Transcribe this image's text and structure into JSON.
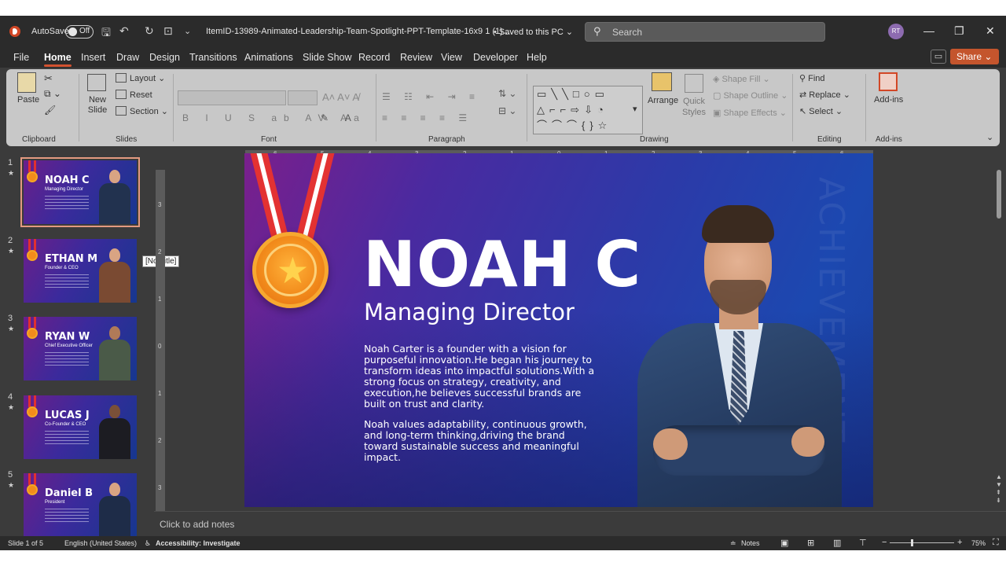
{
  "window": {
    "autosave_label": "AutoSave",
    "autosave_state": "Off",
    "doc_title": "ItemID-13989-Animated-Leadership-Team-Spotlight-PPT-Template-16x9 1 (1)....",
    "saved_status": "• Saved to this PC ⌄",
    "search_placeholder": "Search",
    "avatar_initials": "RT",
    "accent_color": "#d35230"
  },
  "menu": {
    "tabs": [
      "File",
      "Home",
      "Insert",
      "Draw",
      "Design",
      "Transitions",
      "Animations",
      "Slide Show",
      "Record",
      "Review",
      "View",
      "Developer",
      "Help"
    ],
    "active": "Home",
    "share_label": "Share"
  },
  "ribbon": {
    "clipboard": {
      "paste": "Paste",
      "group": "Clipboard"
    },
    "slides": {
      "new_slide": "New Slide",
      "layout": "Layout",
      "reset": "Reset",
      "section": "Section",
      "group": "Slides"
    },
    "font": {
      "group": "Font"
    },
    "paragraph": {
      "group": "Paragraph"
    },
    "drawing": {
      "arrange": "Arrange",
      "quick_styles": "Quick Styles",
      "shape_fill": "Shape Fill",
      "shape_outline": "Shape Outline",
      "shape_effects": "Shape Effects",
      "group": "Drawing"
    },
    "editing": {
      "find": "Find",
      "replace": "Replace",
      "select": "Select",
      "group": "Editing"
    },
    "addins": {
      "addins": "Add-ins",
      "group": "Add-ins"
    }
  },
  "thumbnails": [
    {
      "num": "1",
      "name": "NOAH C",
      "role": "Managing Director",
      "selected": true
    },
    {
      "num": "2",
      "name": "ETHAN M",
      "role": "Founder & CEO",
      "selected": false
    },
    {
      "num": "3",
      "name": "RYAN W",
      "role": "Chief Executive Officer",
      "selected": false
    },
    {
      "num": "4",
      "name": "LUCAS J",
      "role": "Co-Founder & CEO",
      "selected": false
    },
    {
      "num": "5",
      "name": "Daniel B",
      "role": "President",
      "selected": false
    }
  ],
  "tooltip": "[No Title]",
  "ruler": {
    "h_ticks": [
      "6",
      "5",
      "4",
      "3",
      "2",
      "1",
      "0",
      "1",
      "2",
      "3",
      "4",
      "5",
      "6"
    ],
    "v_ticks": [
      "3",
      "2",
      "1",
      "0",
      "1",
      "2",
      "3"
    ]
  },
  "slide": {
    "name": "NOAH C",
    "role": "Managing Director",
    "para1": "Noah Carter is a founder with a vision for purposeful innovation.He began his journey to transform ideas into impactful solutions.With a strong focus on strategy, creativity, and execution,he believes successful brands are built on trust and clarity.",
    "para2": "Noah values adaptability, continuous growth, and long-term thinking,driving the brand toward sustainable success and meaningful impact.",
    "watermark": "ACHIEVEMENT"
  },
  "notes_placeholder": "Click to add notes",
  "status": {
    "slide_info": "Slide 1 of 5",
    "language": "English (United States)",
    "accessibility": "Accessibility: Investigate",
    "notes": "Notes",
    "zoom": "75%"
  }
}
